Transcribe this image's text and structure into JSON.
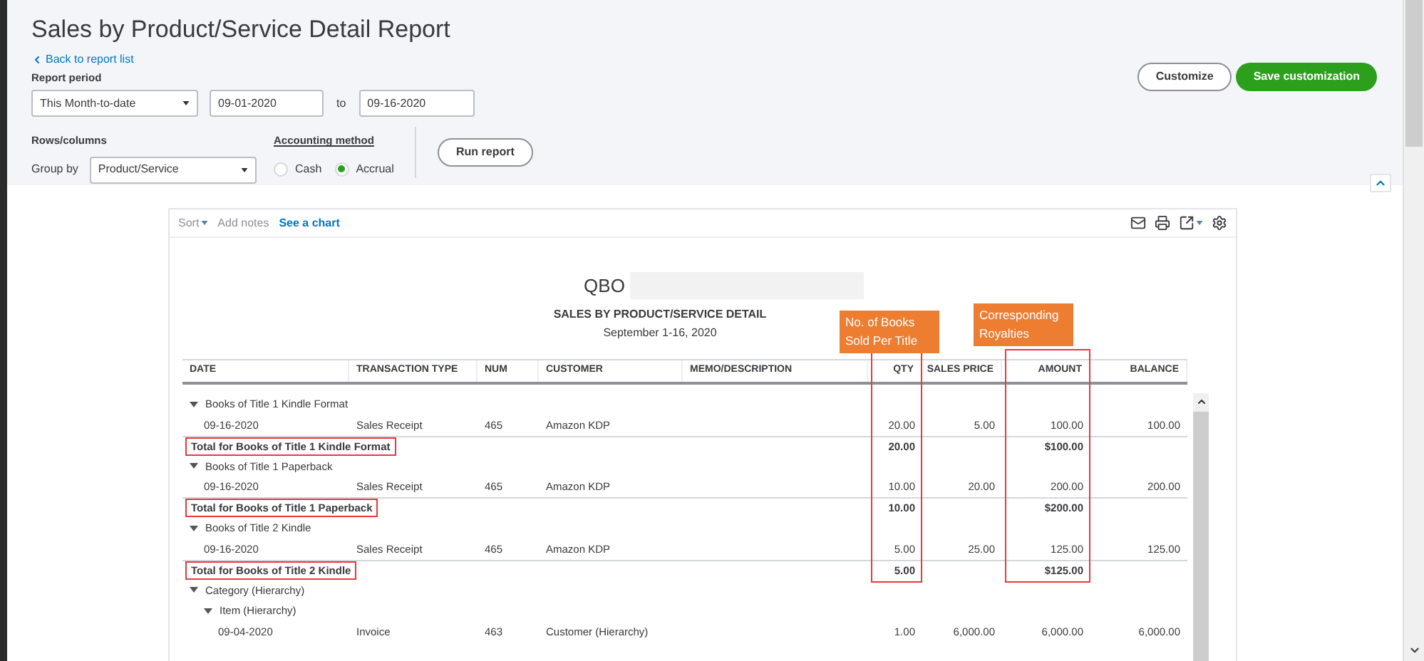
{
  "title": "Sales by Product/Service Detail Report",
  "back_link": "Back to report list",
  "report_period": {
    "label": "Report period",
    "preset": "This Month-to-date",
    "from": "09-01-2020",
    "to_label": "to",
    "to": "09-16-2020"
  },
  "rows_columns": {
    "label": "Rows/columns",
    "group_by_label": "Group by",
    "group_by": "Product/Service"
  },
  "accounting_method": {
    "label": "Accounting method",
    "options": [
      {
        "label": "Cash",
        "selected": false
      },
      {
        "label": "Accrual",
        "selected": true
      }
    ]
  },
  "run_button": "Run report",
  "buttons": [
    {
      "label": "Customize",
      "kind": "secondary"
    },
    {
      "label": "Save customization",
      "kind": "primary"
    }
  ],
  "toolbar": {
    "sort": "Sort",
    "add_notes": "Add notes",
    "chart_link": "See a chart"
  },
  "report": {
    "company": "QBO",
    "title": "SALES BY PRODUCT/SERVICE DETAIL",
    "date_range": "September 1-16, 2020",
    "columns": [
      {
        "label": "DATE"
      },
      {
        "label": "TRANSACTION TYPE"
      },
      {
        "label": "NUM"
      },
      {
        "label": "CUSTOMER"
      },
      {
        "label": "MEMO/DESCRIPTION"
      },
      {
        "label": "QTY",
        "callout": "No. of Books Sold Per Title",
        "highlighted": true
      },
      {
        "label": "SALES PRICE"
      },
      {
        "label": "AMOUNT",
        "callout": "Corresponding Royalties",
        "highlighted": true
      },
      {
        "label": "BALANCE"
      }
    ],
    "rows": [
      {
        "kind": "group",
        "label": "Books of Title 1 Kindle Format",
        "expanded": true,
        "children": [
          {
            "kind": "data",
            "date": "09-16-2020",
            "transaction_type": "Sales Receipt",
            "num": "465",
            "customer": "Amazon KDP",
            "qty": "20.00",
            "sales_price": "5.00",
            "amount": "100.00",
            "balance": "100.00"
          }
        ],
        "total": {
          "label": "Total for Books of Title 1 Kindle Format",
          "qty": "20.00",
          "amount": "$100.00",
          "boxed": true
        }
      },
      {
        "kind": "group",
        "label": "Books of Title 1 Paperback",
        "expanded": true,
        "children": [
          {
            "kind": "data",
            "date": "09-16-2020",
            "transaction_type": "Sales Receipt",
            "num": "465",
            "customer": "Amazon KDP",
            "qty": "10.00",
            "sales_price": "20.00",
            "amount": "200.00",
            "balance": "200.00"
          }
        ],
        "total": {
          "label": "Total for Books of Title 1 Paperback",
          "qty": "10.00",
          "amount": "$200.00",
          "boxed": true
        }
      },
      {
        "kind": "group",
        "label": "Books of Title 2 Kindle",
        "expanded": true,
        "children": [
          {
            "kind": "data",
            "date": "09-16-2020",
            "transaction_type": "Sales Receipt",
            "num": "465",
            "customer": "Amazon KDP",
            "qty": "5.00",
            "sales_price": "25.00",
            "amount": "125.00",
            "balance": "125.00"
          }
        ],
        "total": {
          "label": "Total for Books of Title 2 Kindle",
          "qty": "5.00",
          "amount": "$125.00",
          "boxed": true
        }
      },
      {
        "kind": "group",
        "label": "Category (Hierarchy)",
        "expanded": true,
        "children": [
          {
            "kind": "group",
            "label": "Item (Hierarchy)",
            "expanded": true,
            "children": [
              {
                "kind": "data",
                "date": "09-04-2020",
                "transaction_type": "Invoice",
                "num": "463",
                "customer": "Customer (Hierarchy)",
                "qty": "1.00",
                "sales_price": "6,000.00",
                "amount": "6,000.00",
                "balance": "6,000.00"
              }
            ]
          }
        ]
      }
    ]
  }
}
